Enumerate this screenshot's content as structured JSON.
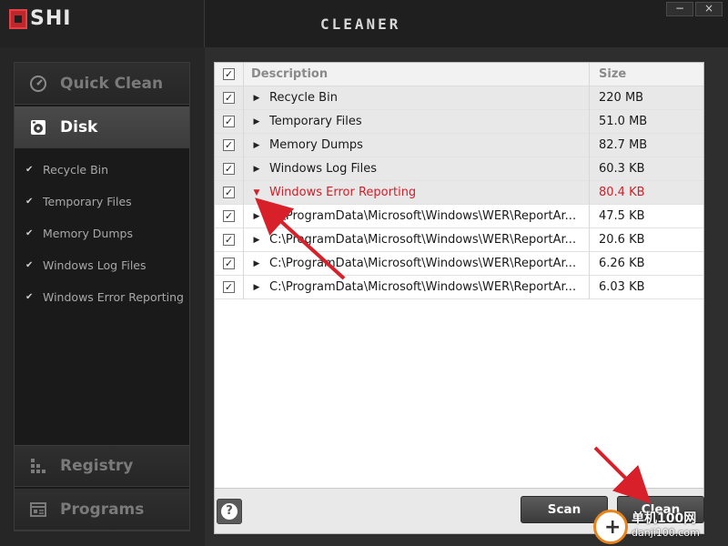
{
  "app": {
    "logo_text": "SHI",
    "title": "CLEANER",
    "minimize_glyph": "−",
    "close_glyph": "×"
  },
  "sidebar": {
    "tabs": [
      {
        "label": "Quick Clean",
        "icon": "speedometer-icon",
        "active": false
      },
      {
        "label": "Disk",
        "icon": "disk-icon",
        "active": true
      },
      {
        "label": "Registry",
        "icon": "registry-icon",
        "active": false
      },
      {
        "label": "Programs",
        "icon": "programs-icon",
        "active": false
      }
    ],
    "disk_items": [
      {
        "label": "Recycle Bin",
        "checked": true
      },
      {
        "label": "Temporary Files",
        "checked": true
      },
      {
        "label": "Memory Dumps",
        "checked": true
      },
      {
        "label": "Windows Log Files",
        "checked": true
      },
      {
        "label": "Windows Error Reporting",
        "checked": true
      }
    ]
  },
  "table": {
    "columns": {
      "description": "Description",
      "size": "Size"
    },
    "rows": [
      {
        "description": "Recycle Bin",
        "size": "220 MB",
        "kind": "group",
        "checked": true
      },
      {
        "description": "Temporary Files",
        "size": "51.0 MB",
        "kind": "group",
        "checked": true
      },
      {
        "description": "Memory Dumps",
        "size": "82.7 MB",
        "kind": "group",
        "checked": true
      },
      {
        "description": "Windows Log Files",
        "size": "60.3 KB",
        "kind": "group",
        "checked": true
      },
      {
        "description": "Windows Error Reporting",
        "size": "80.4 KB",
        "kind": "expanded",
        "checked": true
      },
      {
        "description": "C:\\ProgramData\\Microsoft\\Windows\\WER\\ReportAr...",
        "size": "47.5 KB",
        "kind": "child",
        "checked": true
      },
      {
        "description": "C:\\ProgramData\\Microsoft\\Windows\\WER\\ReportAr...",
        "size": "20.6 KB",
        "kind": "child",
        "checked": true
      },
      {
        "description": "C:\\ProgramData\\Microsoft\\Windows\\WER\\ReportAr...",
        "size": "6.26 KB",
        "kind": "child",
        "checked": true
      },
      {
        "description": "C:\\ProgramData\\Microsoft\\Windows\\WER\\ReportAr...",
        "size": "6.03 KB",
        "kind": "child",
        "checked": true
      }
    ]
  },
  "buttons": {
    "help": "?",
    "scan": "Scan",
    "clean": "Clean"
  },
  "watermark": {
    "line1": "单机100网",
    "line2": "danji100.com"
  },
  "colors": {
    "accent_red": "#d0202a",
    "annotation_arrow": "#d8202a",
    "sidebar_active": "#444444"
  }
}
